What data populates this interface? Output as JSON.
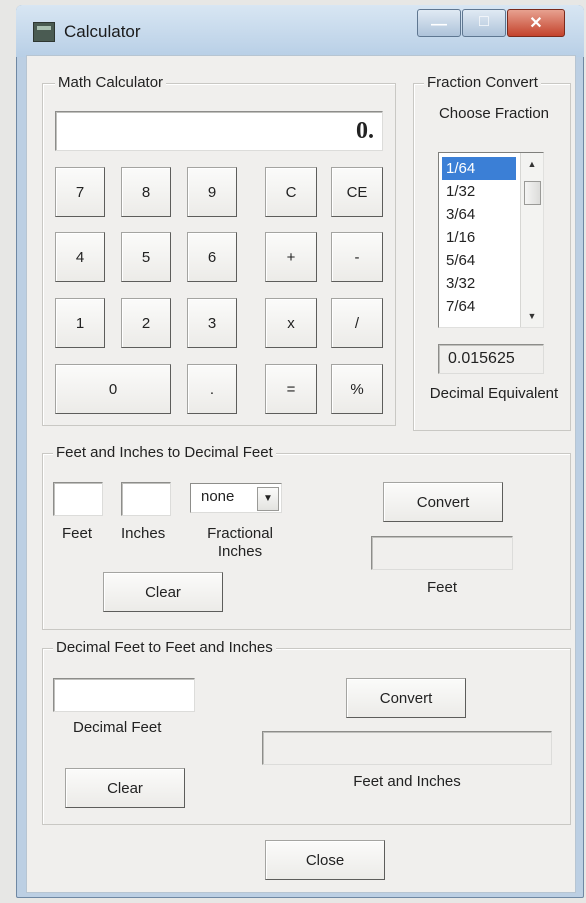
{
  "window": {
    "title": "Calculator"
  },
  "math_calc": {
    "legend": "Math Calculator",
    "display": "0.",
    "keys": [
      "7",
      "8",
      "9",
      "C",
      "CE",
      "4",
      "5",
      "6",
      "+",
      "-",
      "1",
      "2",
      "3",
      "x",
      "/",
      "0",
      ".",
      "=",
      "%"
    ]
  },
  "fraction": {
    "legend": "Fraction Convert",
    "choose_label": "Choose Fraction",
    "items": [
      "1/64",
      "1/32",
      "3/64",
      "1/16",
      "5/64",
      "3/32",
      "7/64"
    ],
    "selected": "1/64",
    "decimal_value": "0.015625",
    "decimal_label": "Decimal Equivalent"
  },
  "feet_inches_to_decimal": {
    "legend": "Feet and Inches to Decimal Feet",
    "feet_label": "Feet",
    "inches_label": "Inches",
    "fractional_value": "none",
    "fractional_label": "Fractional Inches",
    "convert_label": "Convert",
    "result_label": "Feet",
    "clear_label": "Clear"
  },
  "decimal_to_feet_inches": {
    "legend": "Decimal Feet to Feet and Inches",
    "decimal_feet_label": "Decimal Feet",
    "convert_label": "Convert",
    "result_label": "Feet and Inches",
    "clear_label": "Clear"
  },
  "close_label": "Close",
  "icons": [
    "calculator-app-icon",
    "minimize-icon",
    "maximize-icon",
    "close-icon",
    "chevron-down-icon",
    "scroll-up-icon",
    "scroll-down-icon"
  ],
  "colors": {
    "selection": "#3b7fd6",
    "close_button": "#c4432c",
    "titlebar": "#bccfe3"
  }
}
